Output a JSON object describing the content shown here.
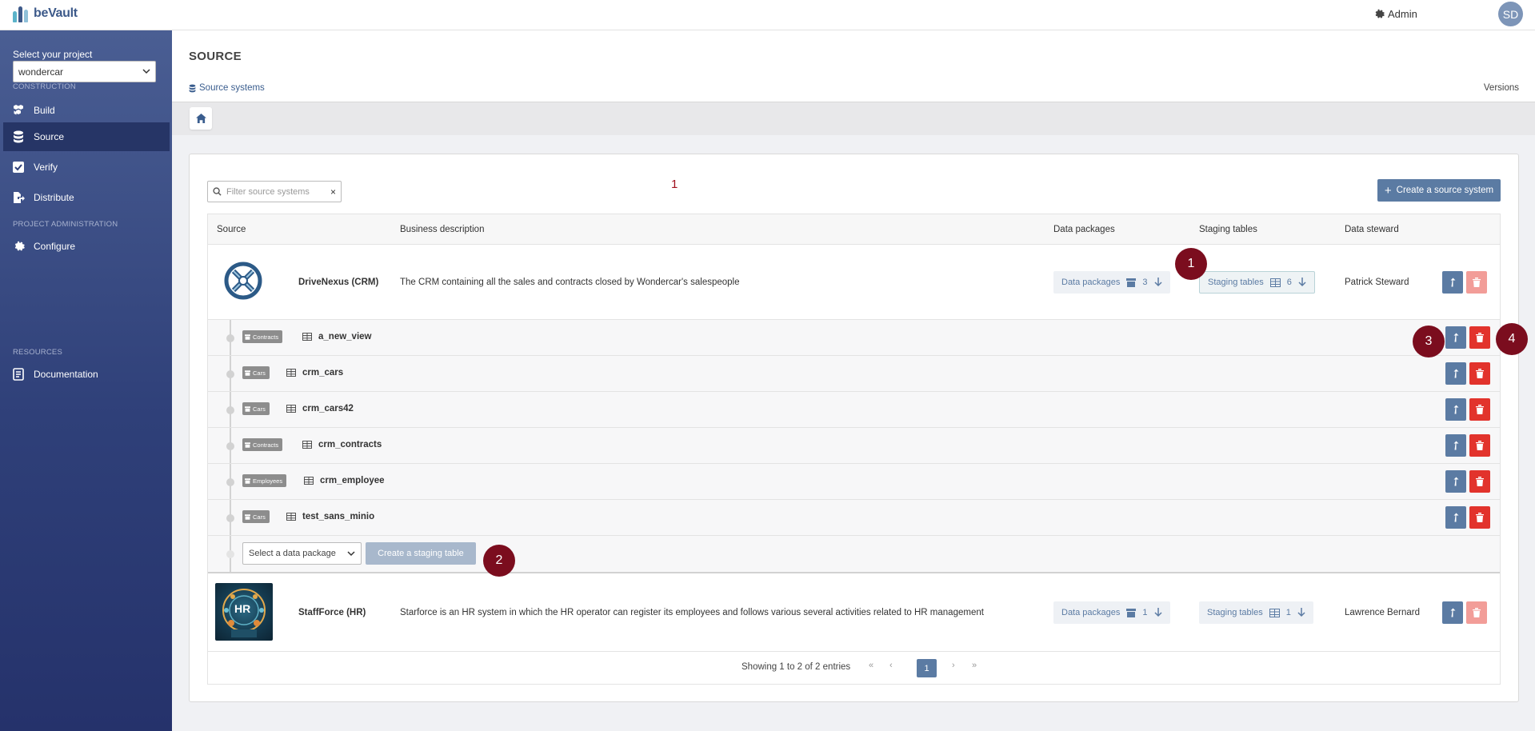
{
  "app": {
    "name": "beVault"
  },
  "topbar": {
    "admin_label": "Admin",
    "avatar_initials": "SD"
  },
  "sidebar": {
    "project_label": "Select your project",
    "project_value": "wondercar",
    "sections": {
      "construction": "CONSTRUCTION",
      "project_admin": "PROJECT ADMINISTRATION",
      "resources": "RESOURCES"
    },
    "items": {
      "build": "Build",
      "source": "Source",
      "verify": "Verify",
      "distribute": "Distribute",
      "configure": "Configure",
      "documentation": "Documentation"
    }
  },
  "page": {
    "title": "SOURCE",
    "tab_source_systems": "Source systems",
    "tab_versions": "Versions"
  },
  "toolbar": {
    "filter_placeholder": "Filter source systems",
    "clear_symbol": "×",
    "create_source_label": "Create a source system"
  },
  "table": {
    "headers": {
      "source": "Source",
      "business_description": "Business description",
      "data_packages": "Data packages",
      "staging_tables": "Staging tables",
      "data_steward": "Data steward"
    },
    "rows": [
      {
        "name": "DriveNexus (CRM)",
        "description": "The CRM containing all the sales and contracts closed by Wondercar's salespeople",
        "data_packages_label": "Data packages",
        "data_packages_count": "3",
        "staging_tables_label": "Staging tables",
        "staging_tables_count": "6",
        "steward": "Patrick Steward"
      },
      {
        "name": "StaffForce (HR)",
        "description": "Starforce is an HR system in which the HR operator can register its employees and follows various several activities related to HR management",
        "data_packages_label": "Data packages",
        "data_packages_count": "1",
        "staging_tables_label": "Staging tables",
        "staging_tables_count": "1",
        "steward": "Lawrence Bernard",
        "logo_text": "HR"
      }
    ],
    "staging_tables": [
      {
        "package": "Contracts",
        "name": "a_new_view"
      },
      {
        "package": "Cars",
        "name": "crm_cars"
      },
      {
        "package": "Cars",
        "name": "crm_cars42"
      },
      {
        "package": "Contracts",
        "name": "crm_contracts"
      },
      {
        "package": "Employees",
        "name": "crm_employee"
      },
      {
        "package": "Cars",
        "name": "test_sans_minio"
      }
    ],
    "add_row": {
      "select_placeholder": "Select a data package",
      "create_label": "Create a staging table"
    }
  },
  "pagination": {
    "info": "Showing 1 to 2 of 2 entries",
    "first": "«",
    "prev": "‹",
    "current": "1",
    "next": "›",
    "last": "»"
  },
  "annotations": {
    "red_text": "1",
    "m1": "1",
    "m2": "2",
    "m3": "3",
    "m4": "4"
  },
  "colors": {
    "primary": "#5b7ba3",
    "danger": "#e2332c",
    "marker": "#7b0d1e",
    "sidebar": "#2f4079"
  }
}
